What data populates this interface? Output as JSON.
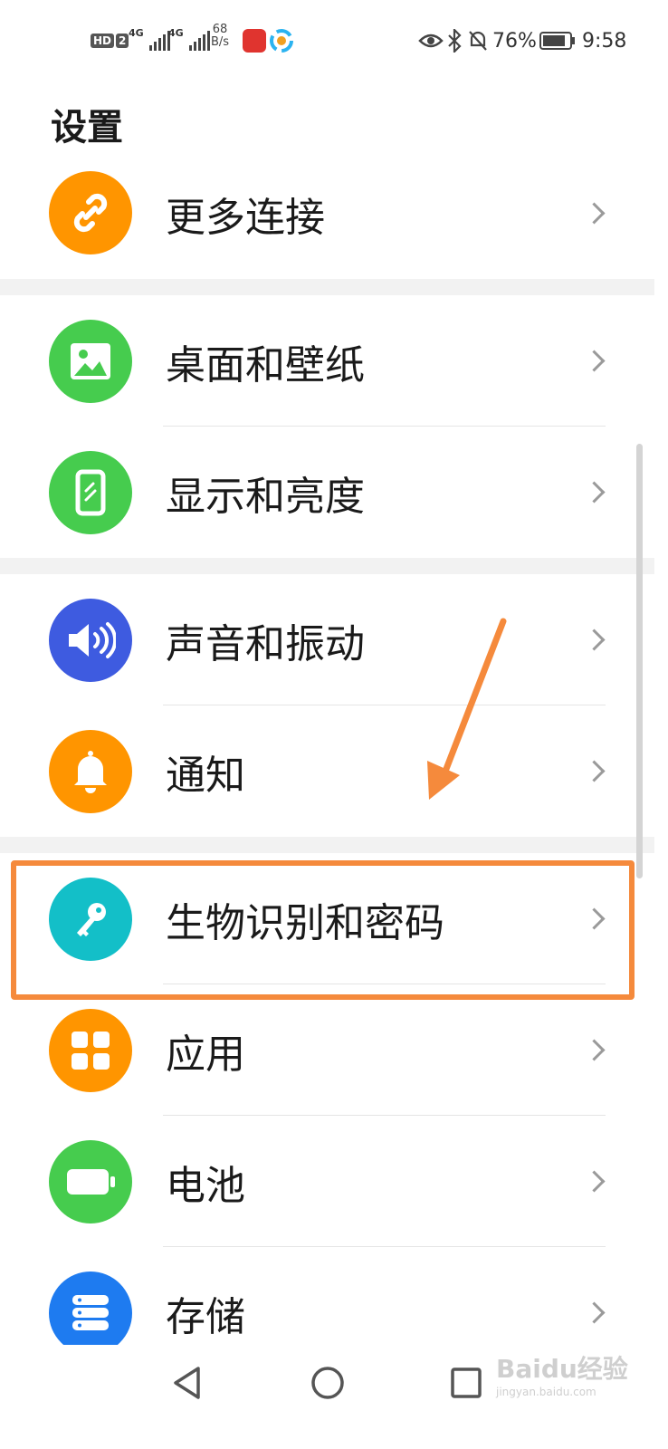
{
  "status_bar": {
    "hd_label": "HD",
    "hd_sub": "2",
    "net1": "4G",
    "net2": "4G",
    "speed_value": "68",
    "speed_unit": "B/s",
    "battery_percent": "76%",
    "time": "9:58"
  },
  "page_title": "设置",
  "items": [
    {
      "label": "更多连接",
      "icon": "link-icon",
      "color": "#FF9500"
    },
    {
      "label": "桌面和壁纸",
      "icon": "image-icon",
      "color": "#46CC4E"
    },
    {
      "label": "显示和亮度",
      "icon": "phone-brightness-icon",
      "color": "#46CC4E"
    },
    {
      "label": "声音和振动",
      "icon": "speaker-icon",
      "color": "#3E5BE0"
    },
    {
      "label": "通知",
      "icon": "bell-icon",
      "color": "#FF9500"
    },
    {
      "label": "生物识别和密码",
      "icon": "key-icon",
      "color": "#13BFC8"
    },
    {
      "label": "应用",
      "icon": "grid-icon",
      "color": "#FF9500"
    },
    {
      "label": "电池",
      "icon": "battery-icon",
      "color": "#46CC4E"
    },
    {
      "label": "存储",
      "icon": "storage-icon",
      "color": "#1E7BF0"
    }
  ],
  "highlight_color": "#F58A3C",
  "watermark": {
    "text": "Baidu经验",
    "sub": "jingyan.baidu.com"
  }
}
